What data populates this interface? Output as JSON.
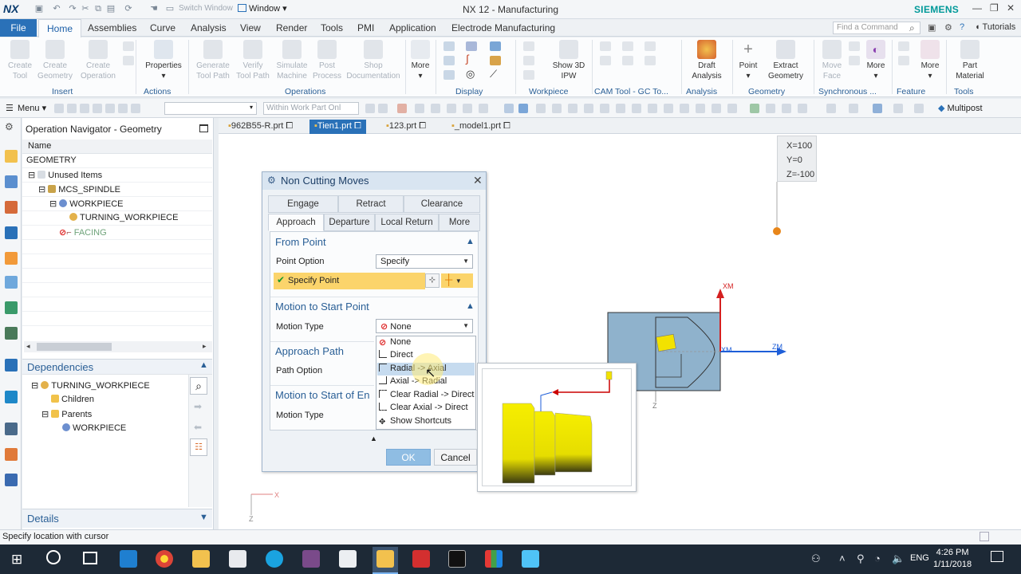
{
  "titlebar": {
    "logo": "NX",
    "switch_window": "Switch Window",
    "window_menu": "Window",
    "title": "NX 12 - Manufacturing",
    "brand": "SIEMENS"
  },
  "menu_tabs": {
    "file": "File",
    "home": "Home",
    "items": [
      "Assemblies",
      "Curve",
      "Analysis",
      "View",
      "Render",
      "Tools",
      "PMI",
      "Application",
      "Electrode Manufacturing"
    ],
    "find_placeholder": "Find a Command",
    "tutorials": "Tutorials"
  },
  "ribbon": {
    "buttons": [
      {
        "label": "Create\nTool",
        "disabled": true
      },
      {
        "label": "Create\nGeometry",
        "disabled": true
      },
      {
        "label": "Create\nOperation",
        "disabled": true
      },
      {
        "label": "Properties",
        "disabled": false
      },
      {
        "label": "Generate\nTool Path",
        "disabled": true
      },
      {
        "label": "Verify\nTool Path",
        "disabled": true
      },
      {
        "label": "Simulate\nMachine",
        "disabled": true
      },
      {
        "label": "Post\nProcess",
        "disabled": true
      },
      {
        "label": "Shop\nDocumentation",
        "disabled": true
      },
      {
        "label": "More",
        "disabled": false
      },
      {
        "label": "Show 3D\nIPW",
        "disabled": false
      },
      {
        "label": "Draft\nAnalysis",
        "disabled": false
      },
      {
        "label": "Point",
        "disabled": false
      },
      {
        "label": "Extract\nGeometry",
        "disabled": false
      },
      {
        "label": "Move\nFace",
        "disabled": true
      },
      {
        "label": "More",
        "disabled": false
      },
      {
        "label": "More",
        "disabled": false
      },
      {
        "label": "Part\nMaterial",
        "disabled": false
      }
    ],
    "groups": [
      "Insert",
      "Actions",
      "Operations",
      "Display",
      "Workpiece",
      "CAM Tool - GC To...",
      "Analysis",
      "Geometry",
      "Synchronous ...",
      "Feature",
      "Tools"
    ]
  },
  "toolbar": {
    "menu": "Menu",
    "work_part": "Within Work Part Onl",
    "multipost": "Multipost"
  },
  "navigator": {
    "title": "Operation Navigator - Geometry",
    "column": "Name",
    "items": [
      {
        "label": "GEOMETRY",
        "indent": 0
      },
      {
        "label": "Unused Items",
        "indent": 1
      },
      {
        "label": "MCS_SPINDLE",
        "indent": 2
      },
      {
        "label": "WORKPIECE",
        "indent": 3
      },
      {
        "label": "TURNING_WORKPIECE",
        "indent": 4
      },
      {
        "label": "FACING",
        "indent": 3
      }
    ]
  },
  "dependencies": {
    "title": "Dependencies",
    "items": [
      "TURNING_WORKPIECE",
      "Children",
      "Parents",
      "WORKPIECE"
    ]
  },
  "details": {
    "title": "Details"
  },
  "file_tabs": [
    "962B55-R.prt",
    "Tien1.prt",
    "123.prt",
    "_model1.prt"
  ],
  "graphics": {
    "coords": [
      "X=100",
      "Y=0",
      "Z=-100"
    ],
    "axis_xm": "XM",
    "axis_zm": "ZM",
    "axis_z": "Z",
    "axis_x": "X"
  },
  "dialog": {
    "title": "Non Cutting Moves",
    "tabs_row1": [
      "Engage",
      "Retract",
      "Clearance"
    ],
    "tabs_row2": [
      "Approach",
      "Departure",
      "Local Return",
      "More"
    ],
    "sec_from_point": "From Point",
    "point_option_label": "Point Option",
    "point_option_value": "Specify",
    "specify_point": "Specify Point",
    "sec_motion_start": "Motion to Start Point",
    "motion_type_label": "Motion Type",
    "motion_type_value": "None",
    "sec_approach_path": "Approach Path",
    "path_option_label": "Path Option",
    "sec_motion_start_en": "Motion to Start of En",
    "motion_type_label2": "Motion Type",
    "dropdown_options": [
      "None",
      "Direct",
      "Radial -> Axial",
      "Axial -> Radial",
      "Clear Radial -> Direct",
      "Clear Axial -> Direct",
      "Show Shortcuts"
    ],
    "ok": "OK",
    "cancel": "Cancel"
  },
  "status": {
    "text": "Specify location with cursor"
  },
  "taskbar": {
    "time": "4:26 PM",
    "date": "1/11/2018",
    "lang": "ENG"
  },
  "colors": {
    "accent": "#2a71b8",
    "highlight": "#fbd46b",
    "selected": "#c6dbef",
    "part_blue": "#8fb2cc",
    "preview_yellow": "#f2e200"
  }
}
